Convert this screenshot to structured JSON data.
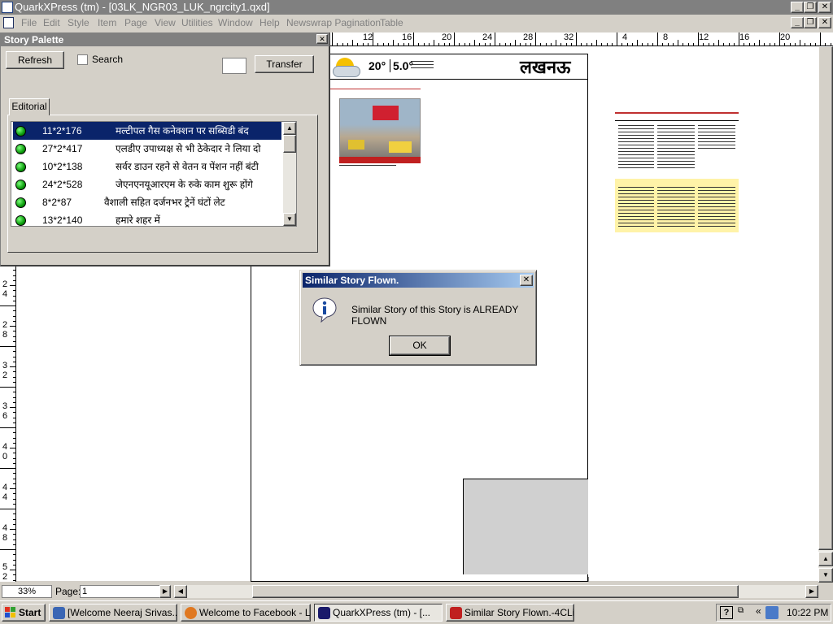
{
  "window": {
    "title": "QuarkXPress (tm) - [03LK_NGR03_LUK_ngrcity1.qxd]"
  },
  "menu": [
    "File",
    "Edit",
    "Style",
    "Item",
    "Page",
    "View",
    "Utilities",
    "Window",
    "Help",
    "Newswrap Pagination",
    "Table"
  ],
  "ruler": {
    "top_labels": [
      "12",
      "16",
      "20",
      "24",
      "28",
      "32",
      "4",
      "8",
      "12",
      "16",
      "20"
    ],
    "left_labels": [
      "2 4",
      "2 8",
      "3 2",
      "3 6",
      "4 0",
      "4 4",
      "4 8",
      "5 2"
    ]
  },
  "palette": {
    "title": "Story Palette",
    "refresh_label": "Refresh",
    "search_label": "Search",
    "transfer_label": "Transfer",
    "tab_label": "Editorial",
    "rows": [
      {
        "code": "11*2*176",
        "title": "मल्टीपल गैस कनेक्शन पर सब्सिडी बंद",
        "selected": true
      },
      {
        "code": "27*2*417",
        "title": "एलडीए उपाध्यक्ष से भी ठेकेदार ने लिया दो",
        "selected": false
      },
      {
        "code": "10*2*138",
        "title": "सर्वर डाउन रहने से वेतन व पेंशन नहीं बंटी",
        "selected": false
      },
      {
        "code": "24*2*528",
        "title": "जेएनएनयूआरएम के रुके काम शुरू होंगे",
        "selected": false
      },
      {
        "code": "8*2*87",
        "title": "वैशाली सहित दर्जनभर ट्रेनें घंटों लेट",
        "selected": false
      },
      {
        "code": "13*2*140",
        "title": "हमारे शहर में",
        "selected": false
      }
    ]
  },
  "page": {
    "masthead": "लखनऊ",
    "temp_max": "20°",
    "temp_min": "5.0°"
  },
  "dialog": {
    "title": "Similar Story Flown.",
    "message": "Similar Story of this Story is ALREADY FLOWN",
    "ok_label": "OK"
  },
  "statusbar": {
    "zoom": "33%",
    "page_label": "Page:",
    "page_value": "1"
  },
  "taskbar": {
    "start_label": "Start",
    "tasks": [
      {
        "label": "[Welcome Neeraj  Srivas...",
        "active": false,
        "color": "#3a66b4"
      },
      {
        "label": "Welcome to Facebook - L...",
        "active": false,
        "color": "#e07820"
      },
      {
        "label": "QuarkXPress (tm) - [...",
        "active": true,
        "color": "#1a1a6a"
      },
      {
        "label": "Similar Story Flown.-4CLi...",
        "active": false,
        "color": "#c02020"
      }
    ],
    "clock": "10:22 PM"
  }
}
